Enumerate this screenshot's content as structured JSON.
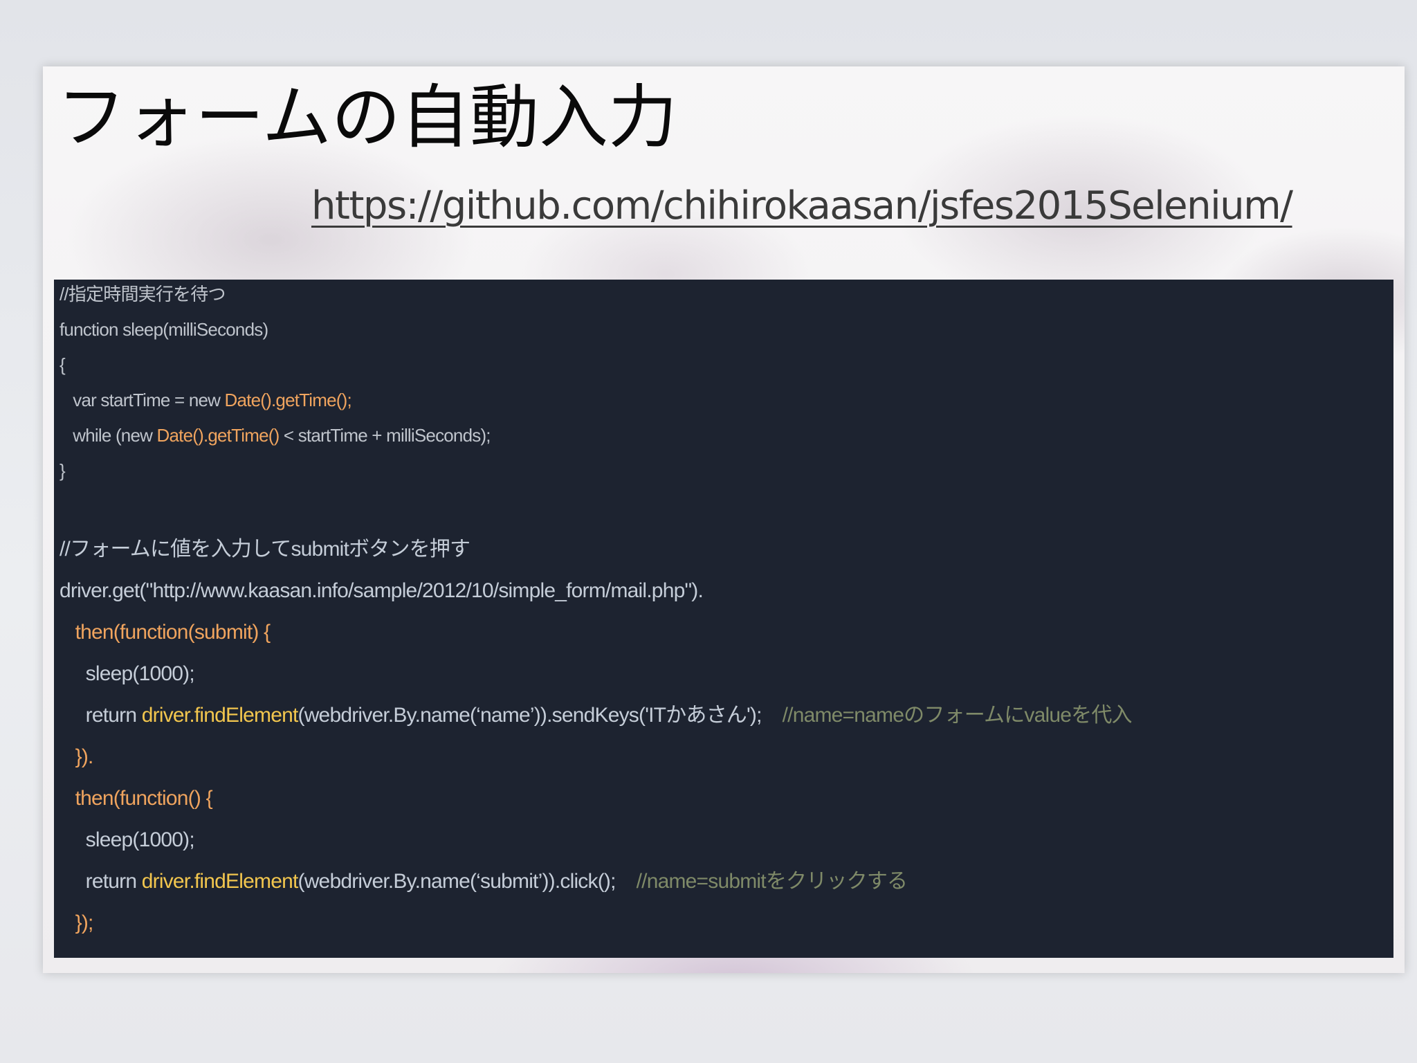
{
  "slide": {
    "title": "フォームの自動入力",
    "link": "https://github.com/chihirokaasan/jsfes2015Selenium/"
  },
  "code": {
    "block1": {
      "comment": "//指定時間実行を待つ",
      "fn_decl": "function sleep(milliSeconds)",
      "open_brace": "{",
      "var_prefix": "   var startTime = new ",
      "var_call": "Date().getTime();",
      "while_prefix": "   while (new ",
      "while_call": "Date().getTime()",
      "while_suffix": " < startTime + milliSeconds);",
      "close_brace": "}"
    },
    "block2": {
      "comment": "//フォームに値を入力してsubmitボタンを押す",
      "driver_get": "driver.get(\"http://www.kaasan.info/sample/2012/10/simple_form/mail.php\").",
      "then1": "   then(function(submit) {",
      "sleep1": "     sleep(1000);",
      "return1_prefix": "     return ",
      "return1_method": "driver.findElement",
      "return1_suffix": "(webdriver.By.name(‘name’)).sendKeys('ITかあさん');",
      "return1_comment": "//name=nameのフォームにvalueを代入",
      "close1": "   }).",
      "then2": "   then(function() {",
      "sleep2": "     sleep(1000);",
      "return2_prefix": "     return ",
      "return2_method": "driver.findElement",
      "return2_suffix": "(webdriver.By.name(‘submit’)).click();",
      "return2_comment": "//name=submitをクリックする",
      "close2": "   });"
    }
  },
  "colors": {
    "panel_background": "#1d2330",
    "code_text": "#c5cdd8",
    "code_orange": "#f0a45e",
    "code_yellow": "#f2c64e",
    "code_comment": "#7f8a68"
  }
}
